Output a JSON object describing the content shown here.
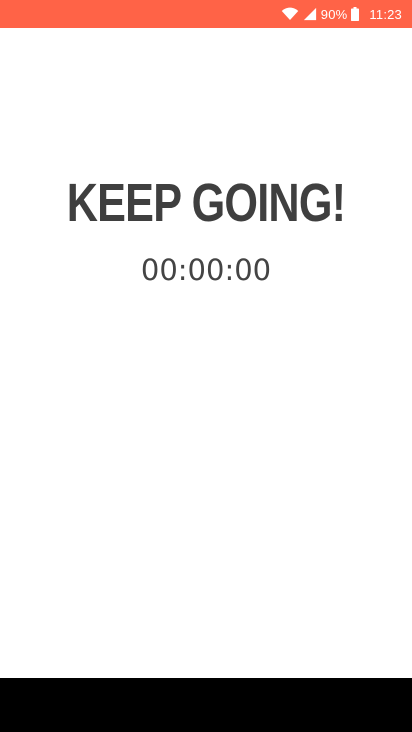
{
  "colors": {
    "status_bar": "#ff6347",
    "background": "#ffffff",
    "headline": "#3f3f3f",
    "timer": "#444444",
    "nav_bar": "#000000"
  },
  "status_bar": {
    "battery_percent": "90%",
    "time": "11:23",
    "icons": [
      "wifi-icon",
      "cell-signal-icon",
      "battery-icon"
    ]
  },
  "main": {
    "headline": "KEEP GOING!",
    "timer": "00:00:00"
  }
}
